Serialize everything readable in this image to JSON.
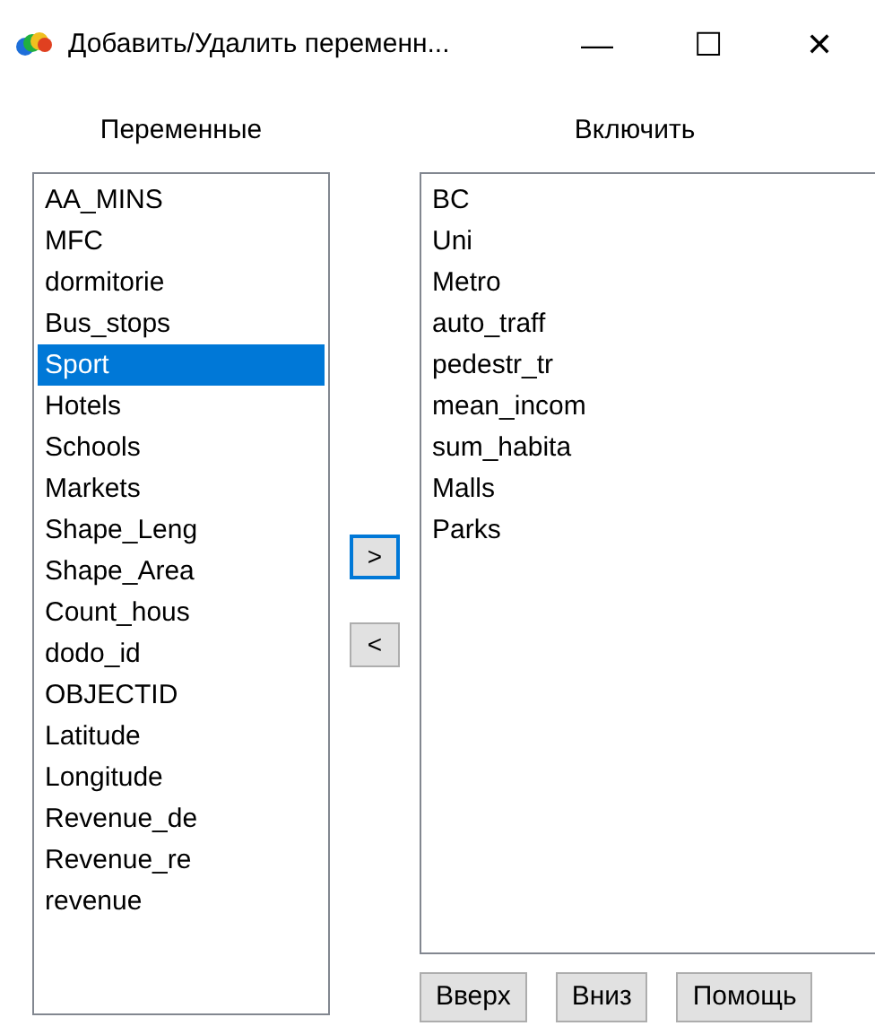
{
  "window": {
    "title": "Добавить/Удалить переменн...",
    "controls": [
      "—",
      "☐",
      "✕"
    ]
  },
  "available": {
    "label": "Переменные",
    "items": [
      {
        "text": "AA_MINS",
        "selected": false
      },
      {
        "text": "MFC",
        "selected": false
      },
      {
        "text": "dormitorie",
        "selected": false
      },
      {
        "text": "Bus_stops",
        "selected": false
      },
      {
        "text": "Sport",
        "selected": true
      },
      {
        "text": "Hotels",
        "selected": false
      },
      {
        "text": "Schools",
        "selected": false
      },
      {
        "text": "Markets",
        "selected": false
      },
      {
        "text": "Shape_Leng",
        "selected": false
      },
      {
        "text": "Shape_Area",
        "selected": false
      },
      {
        "text": "Count_hous",
        "selected": false
      },
      {
        "text": "dodo_id",
        "selected": false
      },
      {
        "text": "OBJECTID",
        "selected": false
      },
      {
        "text": "Latitude",
        "selected": false
      },
      {
        "text": "Longitude",
        "selected": false
      },
      {
        "text": "Revenue_de",
        "selected": false
      },
      {
        "text": "Revenue_re",
        "selected": false
      },
      {
        "text": "revenue",
        "selected": false
      }
    ]
  },
  "move_buttons": [
    {
      "label": ">",
      "focused": true
    },
    {
      "label": "<",
      "focused": false
    }
  ],
  "included": {
    "label": "Включить",
    "items": [
      {
        "text": "BC",
        "selected": false
      },
      {
        "text": "Uni",
        "selected": false
      },
      {
        "text": "Metro",
        "selected": false
      },
      {
        "text": "auto_traff",
        "selected": false
      },
      {
        "text": "pedestr_tr",
        "selected": false
      },
      {
        "text": "mean_incom",
        "selected": false
      },
      {
        "text": "sum_habita",
        "selected": false
      },
      {
        "text": "Malls",
        "selected": false
      },
      {
        "text": "Parks",
        "selected": false
      }
    ]
  },
  "buttons": [
    "Вверх",
    "Вниз",
    "Помощь"
  ]
}
